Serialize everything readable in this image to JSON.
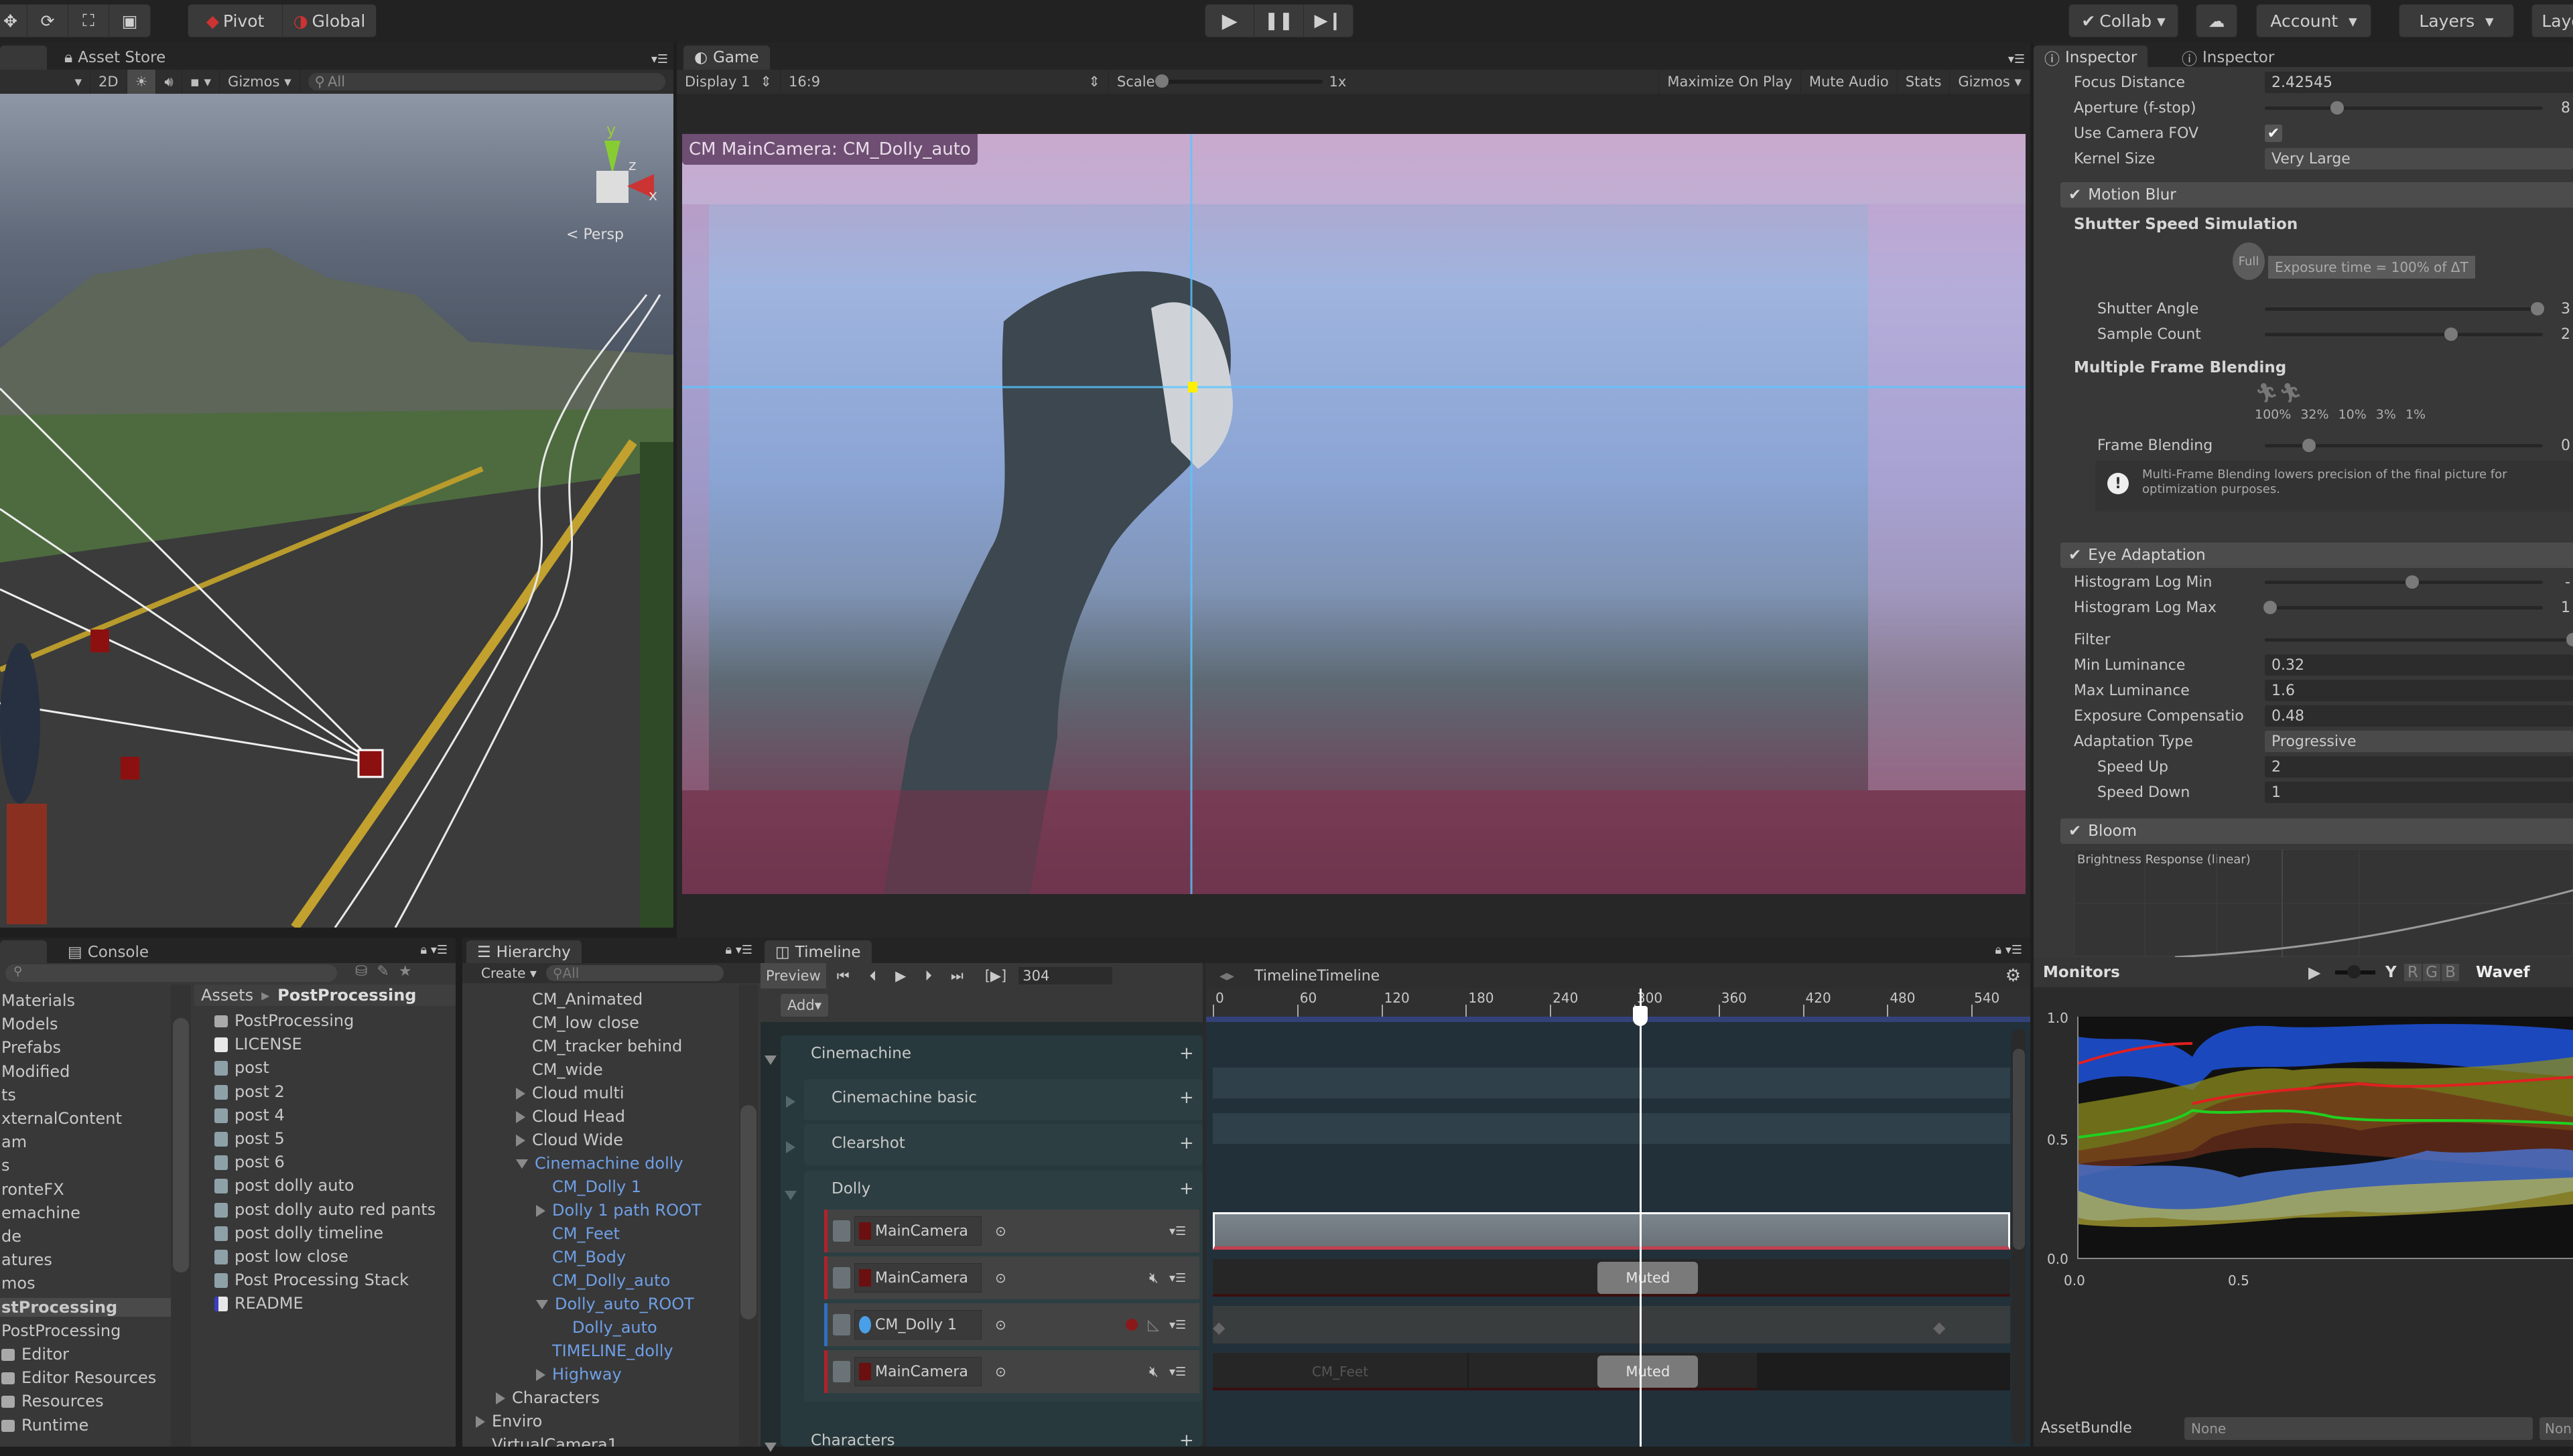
{
  "toolbar": {
    "transform_tools": [
      "move-tool",
      "rotate-tool",
      "scale-tool",
      "rect-tool"
    ],
    "pivot_label": "Pivot",
    "global_label": "Global",
    "play_controls": [
      "play",
      "pause",
      "step"
    ],
    "collab_label": "Collab",
    "account_label": "Account",
    "layers_label": "Layers",
    "layout_label": "Layo"
  },
  "scene_view": {
    "tab_label": "Asset Store",
    "mode_2d": "2D",
    "gizmos_label": "Gizmos",
    "search_placeholder": "All",
    "persp_label": "Persp",
    "gizmo_axes": {
      "y": "y",
      "z": "z",
      "x": "x"
    }
  },
  "game_view": {
    "tab_label": "Game",
    "display": "Display 1",
    "aspect": "16:9",
    "scale_label": "Scale",
    "scale_value": "1x",
    "maximize_on_play": "Maximize On Play",
    "mute_audio": "Mute Audio",
    "stats": "Stats",
    "gizmos": "Gizmos",
    "camera_overlay": "CM MainCamera: CM_Dolly_auto"
  },
  "inspector": {
    "tabs": [
      "Inspector",
      "Inspector"
    ],
    "rows_top": [
      {
        "label": "Focus Distance",
        "value": "2.42545",
        "type": "field"
      },
      {
        "label": "Aperture (f-stop)",
        "value": "8",
        "type": "slider",
        "fraction": 0.26
      },
      {
        "label": "Use Camera FOV",
        "value": "checked",
        "type": "checkbox"
      },
      {
        "label": "Kernel Size",
        "value": "Very Large",
        "type": "dropdown"
      }
    ],
    "motion_blur": {
      "label": "Motion Blur",
      "enabled": true,
      "shutter_title": "Shutter Speed Simulation",
      "full_label": "Full",
      "exposure_text": "Exposure time = 100% of ΔT",
      "shutter_angle_label": "Shutter Angle",
      "shutter_angle_value": "3",
      "shutter_angle_fraction": 0.98,
      "sample_count_label": "Sample Count",
      "sample_count_value": "2",
      "sample_count_fraction": 0.67,
      "frame_blending_title": "Multiple Frame Blending",
      "blend_percents": [
        "100%",
        "32%",
        "10%",
        "3%",
        "1%"
      ],
      "frame_blending_label": "Frame Blending",
      "frame_blending_value": "0",
      "frame_blending_fraction": 0.16,
      "help_text": "Multi-Frame Blending lowers precision of the final picture for optimization purposes."
    },
    "eye_adaptation": {
      "label": "Eye Adaptation",
      "enabled": true,
      "histogram_min_label": "Histogram Log Min",
      "histogram_min_value": "-",
      "histogram_min_fraction": 0.53,
      "histogram_max_label": "Histogram Log Max",
      "histogram_max_value": "1",
      "histogram_max_fraction": 0.02,
      "filter_label": "Filter",
      "filter_fraction": 1.0,
      "fields": [
        {
          "label": "Min Luminance",
          "value": "0.32"
        },
        {
          "label": "Max Luminance",
          "value": "1.6"
        },
        {
          "label": "Exposure Compensatio",
          "value": "0.48"
        }
      ],
      "adaptation_type_label": "Adaptation Type",
      "adaptation_type_value": "Progressive",
      "speed_up_label": "Speed Up",
      "speed_up_value": "2",
      "speed_down_label": "Speed Down",
      "speed_down_value": "1"
    },
    "bloom": {
      "label": "Bloom",
      "enabled": true,
      "curve_title": "Brightness Response (linear)"
    }
  },
  "monitors": {
    "title": "Monitors",
    "channels": [
      "Y",
      "R",
      "G",
      "B"
    ],
    "mode_label": "Wavef",
    "y_ticks": [
      "1.0",
      "0.5",
      "0.0"
    ],
    "x_ticks": [
      "0.0",
      "0.5"
    ],
    "assetbundle_label": "AssetBundle",
    "assetbundle_value": "None",
    "assetbundle_variant": "Non"
  },
  "project": {
    "tab_label": "Console",
    "tree": [
      "Materials",
      "Models",
      "Prefabs",
      "Modified",
      "ts",
      "xternalContent",
      "am",
      "s",
      "ronteFX",
      "emachine",
      "de",
      "atures",
      "mos",
      "stProcessing",
      "PostProcessing",
      "Editor",
      "Editor Resources",
      "Resources",
      "Runtime"
    ],
    "selected_tree_index": 13,
    "breadcrumb_root": "Assets",
    "breadcrumb_current": "PostProcessing",
    "files": [
      {
        "name": "PostProcessing",
        "icon": "folder"
      },
      {
        "name": "LICENSE",
        "icon": "doc"
      },
      {
        "name": "post",
        "icon": "asset"
      },
      {
        "name": "post 2",
        "icon": "asset"
      },
      {
        "name": "post 4",
        "icon": "asset"
      },
      {
        "name": "post 5",
        "icon": "asset"
      },
      {
        "name": "post 6",
        "icon": "asset"
      },
      {
        "name": "post dolly auto",
        "icon": "asset"
      },
      {
        "name": "post dolly auto red pants",
        "icon": "asset"
      },
      {
        "name": "post dolly timeline",
        "icon": "asset"
      },
      {
        "name": "post low close",
        "icon": "asset"
      },
      {
        "name": "Post Processing Stack",
        "icon": "asset"
      },
      {
        "name": "README",
        "icon": "readme"
      }
    ]
  },
  "hierarchy": {
    "tab_label": "Hierarchy",
    "create_label": "Create",
    "search_placeholder": "All",
    "items": [
      {
        "name": "CM_Animated",
        "depth": 2,
        "arrow": "",
        "highlight": false
      },
      {
        "name": "CM_low close",
        "depth": 2,
        "arrow": "",
        "highlight": false
      },
      {
        "name": "CM_tracker behind",
        "depth": 2,
        "arrow": "",
        "highlight": false
      },
      {
        "name": "CM_wide",
        "depth": 2,
        "arrow": "",
        "highlight": false
      },
      {
        "name": "Cloud multi",
        "depth": 2,
        "arrow": "right",
        "highlight": false
      },
      {
        "name": "Cloud Head",
        "depth": 2,
        "arrow": "right",
        "highlight": false
      },
      {
        "name": "Cloud Wide",
        "depth": 2,
        "arrow": "right",
        "highlight": false
      },
      {
        "name": "Cinemachine dolly",
        "depth": 2,
        "arrow": "down",
        "highlight": true
      },
      {
        "name": "CM_Dolly 1",
        "depth": 3,
        "arrow": "",
        "highlight": true
      },
      {
        "name": "Dolly 1 path ROOT",
        "depth": 3,
        "arrow": "right",
        "highlight": true
      },
      {
        "name": "CM_Feet",
        "depth": 3,
        "arrow": "",
        "highlight": true
      },
      {
        "name": "CM_Body",
        "depth": 3,
        "arrow": "",
        "highlight": true
      },
      {
        "name": "CM_Dolly_auto",
        "depth": 3,
        "arrow": "",
        "highlight": true
      },
      {
        "name": "Dolly_auto_ROOT",
        "depth": 3,
        "arrow": "down",
        "highlight": true
      },
      {
        "name": "Dolly_auto",
        "depth": 4,
        "arrow": "",
        "highlight": true
      },
      {
        "name": "TIMELINE_dolly",
        "depth": 3,
        "arrow": "",
        "highlight": true
      },
      {
        "name": "Highway",
        "depth": 3,
        "arrow": "right",
        "highlight": true
      },
      {
        "name": "Characters",
        "depth": 1,
        "arrow": "right",
        "highlight": false
      },
      {
        "name": "Enviro",
        "depth": 0,
        "arrow": "right",
        "highlight": false
      },
      {
        "name": "VirtualCamera1",
        "depth": 0,
        "arrow": "",
        "highlight": false
      }
    ]
  },
  "timeline": {
    "tab_label": "Timeline",
    "preview_label": "Preview",
    "frame": "304",
    "add_label": "Add",
    "asset_name": "TimelineTimeline",
    "ruler": [
      "0",
      "60",
      "120",
      "180",
      "240",
      "300",
      "360",
      "420",
      "480",
      "540"
    ],
    "playhead_frame": 304,
    "ruler_max": 570,
    "groups": [
      {
        "name": "Cinemachine",
        "expanded": true
      },
      {
        "name": "Cinemachine basic",
        "expanded": false
      },
      {
        "name": "Clearshot",
        "expanded": false
      },
      {
        "name": "Dolly",
        "expanded": true
      },
      {
        "name": "Characters",
        "expanded": true
      }
    ],
    "tracks": [
      {
        "name": "MainCamera",
        "color": "#b0222a",
        "clip": "full",
        "muted": false
      },
      {
        "name": "MainCamera",
        "color": "#b0222a",
        "clip": "muted",
        "muted": true
      },
      {
        "name": "CM_Dolly 1",
        "color": "#2f6fc0",
        "clip": "anim",
        "muted": false
      },
      {
        "name": "MainCamera",
        "color": "#b0222a",
        "clip": "muted",
        "muted": true
      }
    ],
    "clip_labels": {
      "muted": "Muted",
      "cm_feet": "CM_Feet"
    }
  }
}
